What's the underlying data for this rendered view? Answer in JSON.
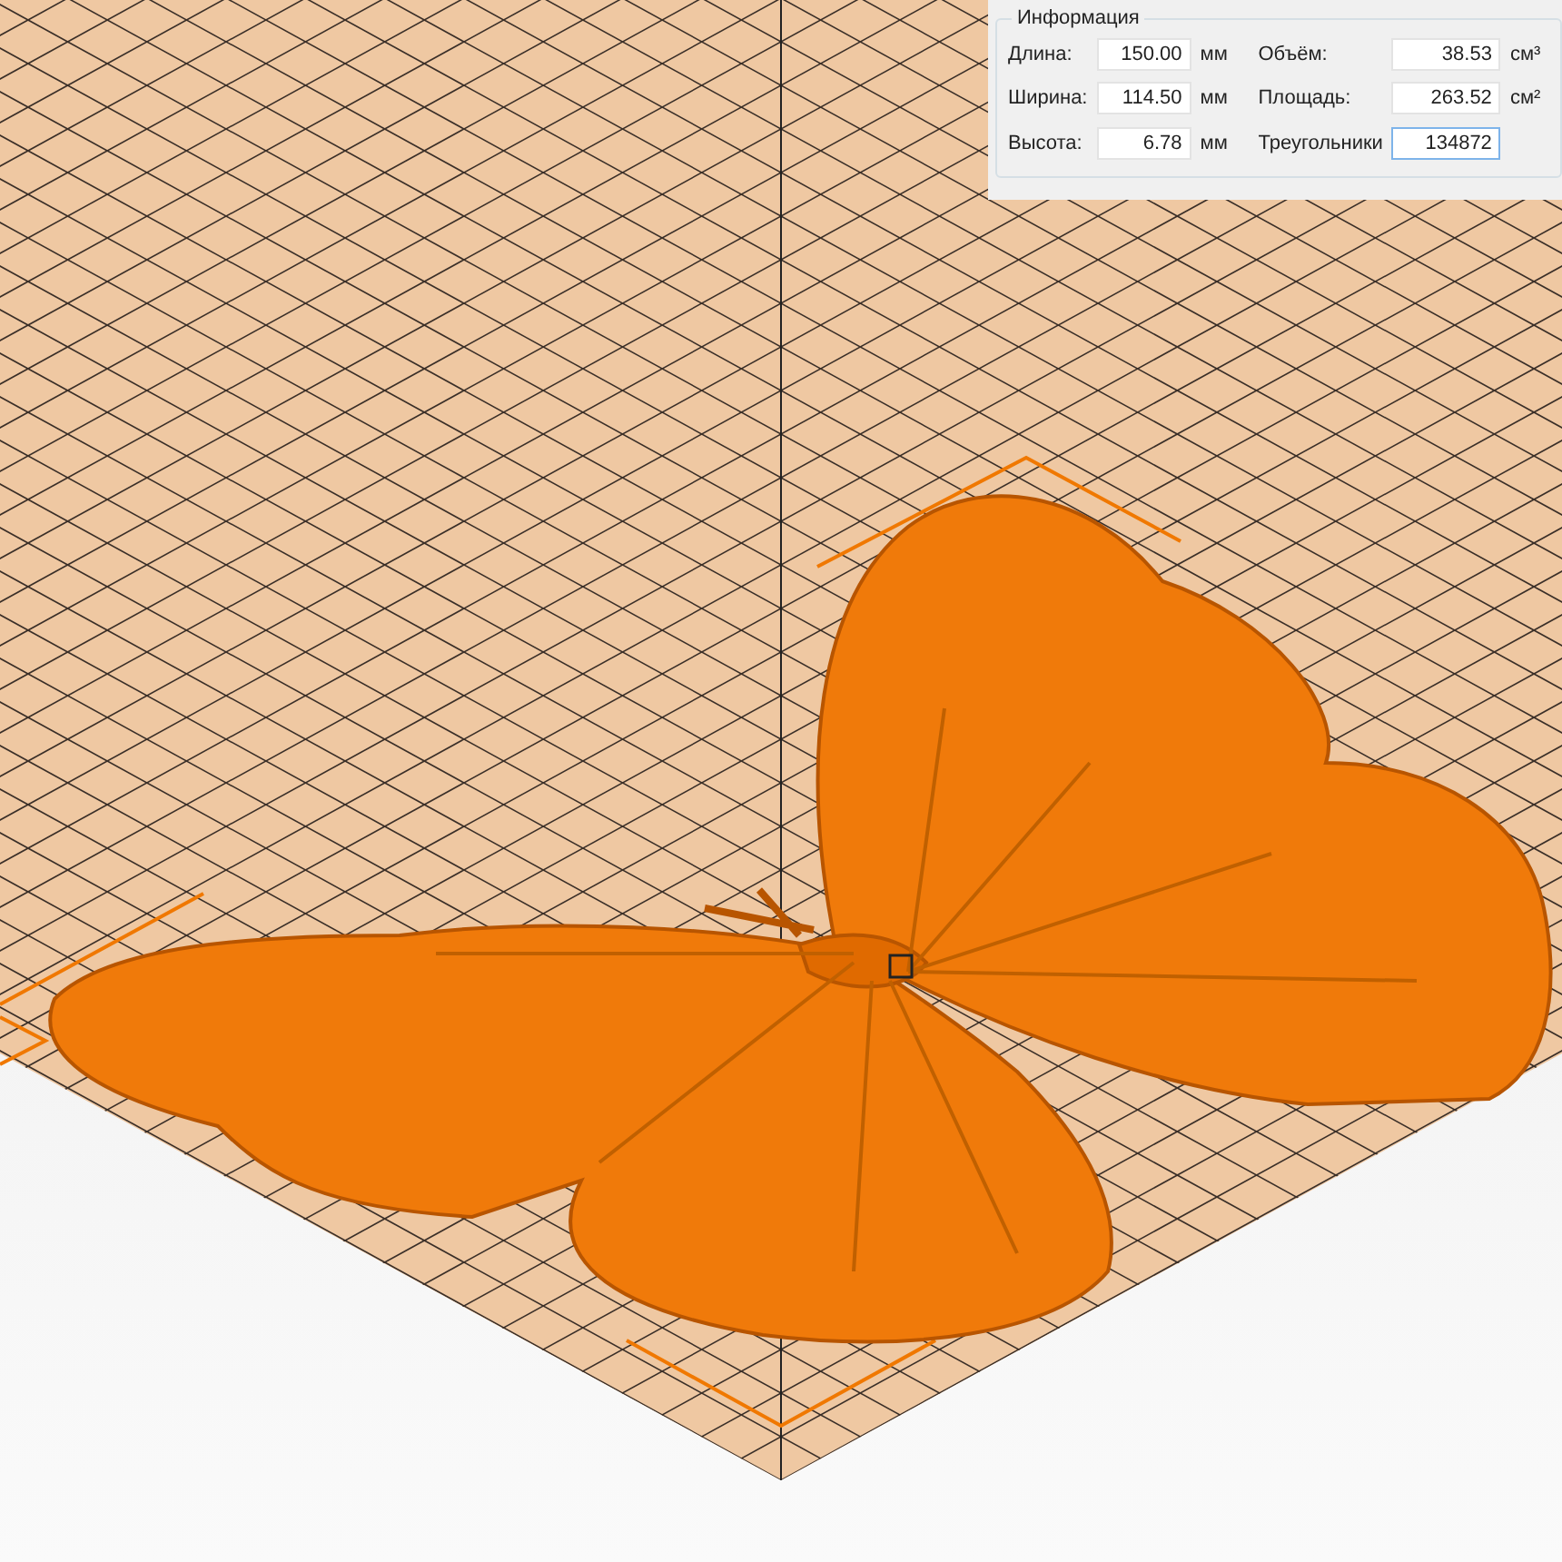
{
  "info_panel": {
    "title": "Информация",
    "left_fields": [
      {
        "label": "Длина:",
        "value": "150.00",
        "unit": "мм",
        "focused": false
      },
      {
        "label": "Ширина:",
        "value": "114.50",
        "unit": "мм",
        "focused": false
      },
      {
        "label": "Высота:",
        "value": "6.78",
        "unit": "мм",
        "focused": false
      }
    ],
    "right_fields": [
      {
        "label": "Объём:",
        "value": "38.53",
        "unit": "см³",
        "focused": false
      },
      {
        "label": "Площадь:",
        "value": "263.52",
        "unit": "см²",
        "focused": false
      },
      {
        "label": "Треугольники",
        "value": "134872",
        "focused": true
      }
    ]
  }
}
